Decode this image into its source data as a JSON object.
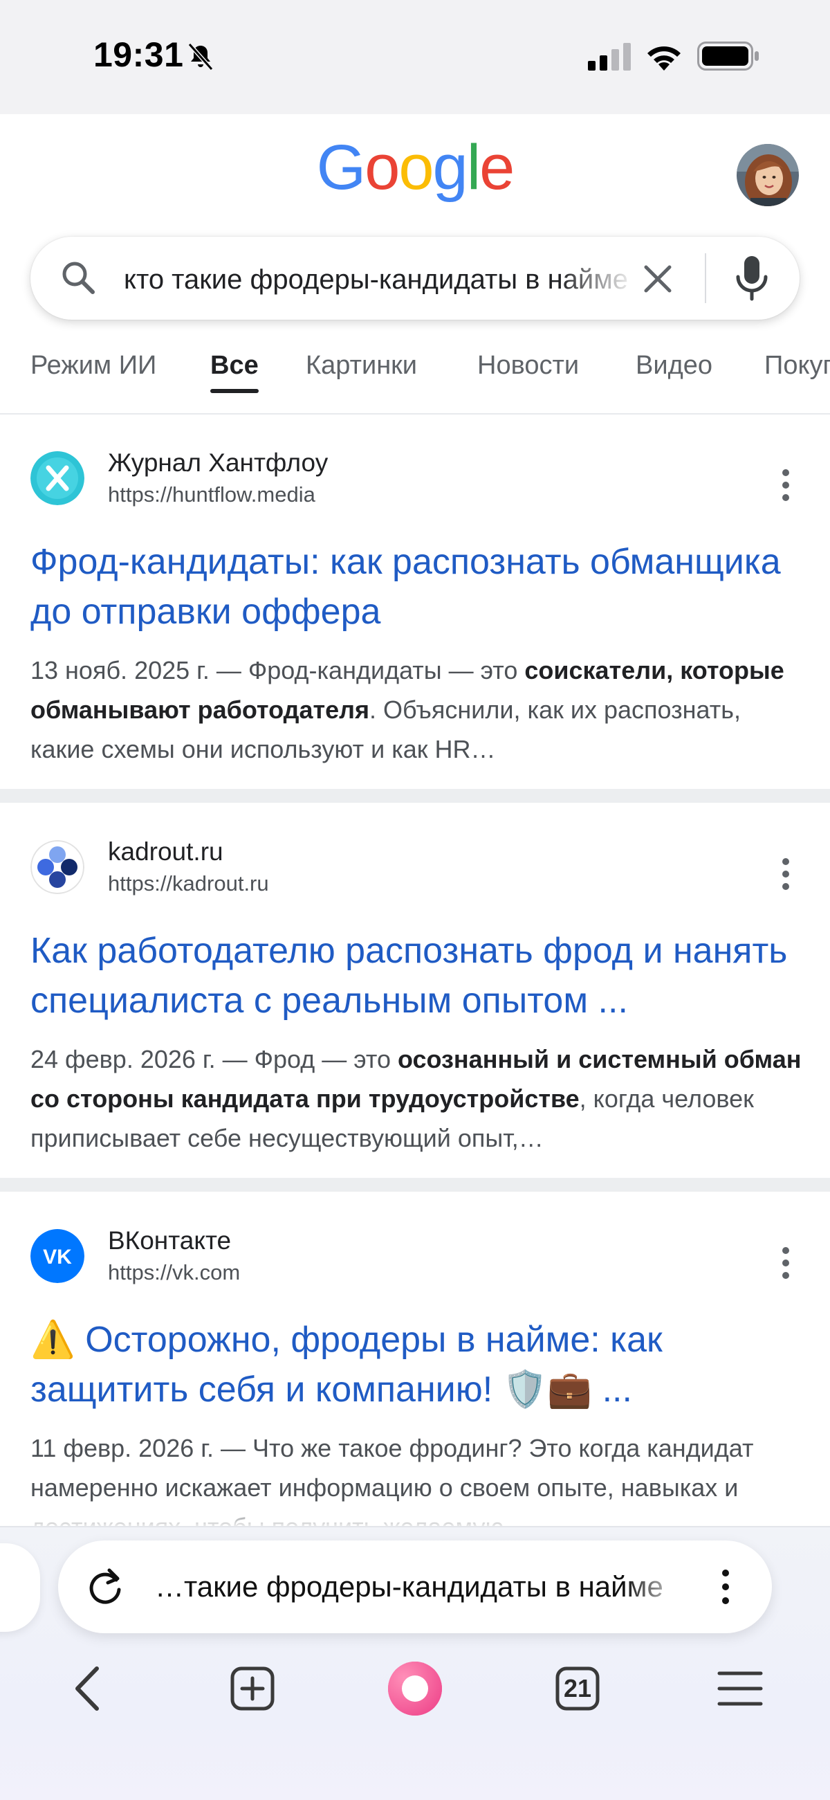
{
  "status_bar": {
    "time": "19:31"
  },
  "header": {
    "logo_letters": [
      "G",
      "o",
      "o",
      "g",
      "l",
      "e"
    ],
    "avatar_alt": "account avatar"
  },
  "search": {
    "query": "кто такие фродеры-кандидаты в найме"
  },
  "tabs": [
    {
      "label": "Режим ИИ",
      "active": false
    },
    {
      "label": "Все",
      "active": true
    },
    {
      "label": "Картинки",
      "active": false
    },
    {
      "label": "Новости",
      "active": false
    },
    {
      "label": "Видео",
      "active": false
    },
    {
      "label": "Покупки",
      "active": false
    }
  ],
  "results": [
    {
      "site_name": "Журнал Хантфлоу",
      "url": "https://huntflow.media",
      "title": "Фрод-кандидаты: как распознать обманщика до отправки оффера",
      "date": "13 нояб. 2025 г. — Фрод-кандидаты — это ",
      "bold": "соискатели, которые обманывают работодателя",
      "rest": ". Объяснили, как их распознать, какие схемы они используют и как HR…",
      "favicon_color": "#2ec4d6"
    },
    {
      "site_name": "kadrout.ru",
      "url": "https://kadrout.ru",
      "title": "Как работодателю распознать фрод и нанять специалиста с реальным опытом ...",
      "date": "24 февр. 2026 г. — Фрод — это ",
      "bold": "осознанный и системный обман со стороны кандидата при трудоустройстве",
      "rest": ", когда человек приписывает себе несуществующий опыт,…",
      "favicon_color": "#2a57c9"
    },
    {
      "site_name": "ВКонтакте",
      "url": "https://vk.com",
      "title_warning": "⚠️",
      "title": "Осторожно, фродеры в найме: как защитить себя и компанию! 🛡️💼 ...",
      "date": "11 февр. 2026 г. — ",
      "bold": "",
      "rest": "Что же такое фродинг? Это когда кандидат намеренно искажает информацию о своем опыте, навыках и достижениях, чтобы получить желаемую",
      "favicon_color": "#0077ff"
    }
  ],
  "browser": {
    "address": "…такие фродеры-кандидаты в найме",
    "tab_count": "21"
  },
  "colors": {
    "link": "#1f5bc4",
    "alice": "#ff5fa0"
  }
}
